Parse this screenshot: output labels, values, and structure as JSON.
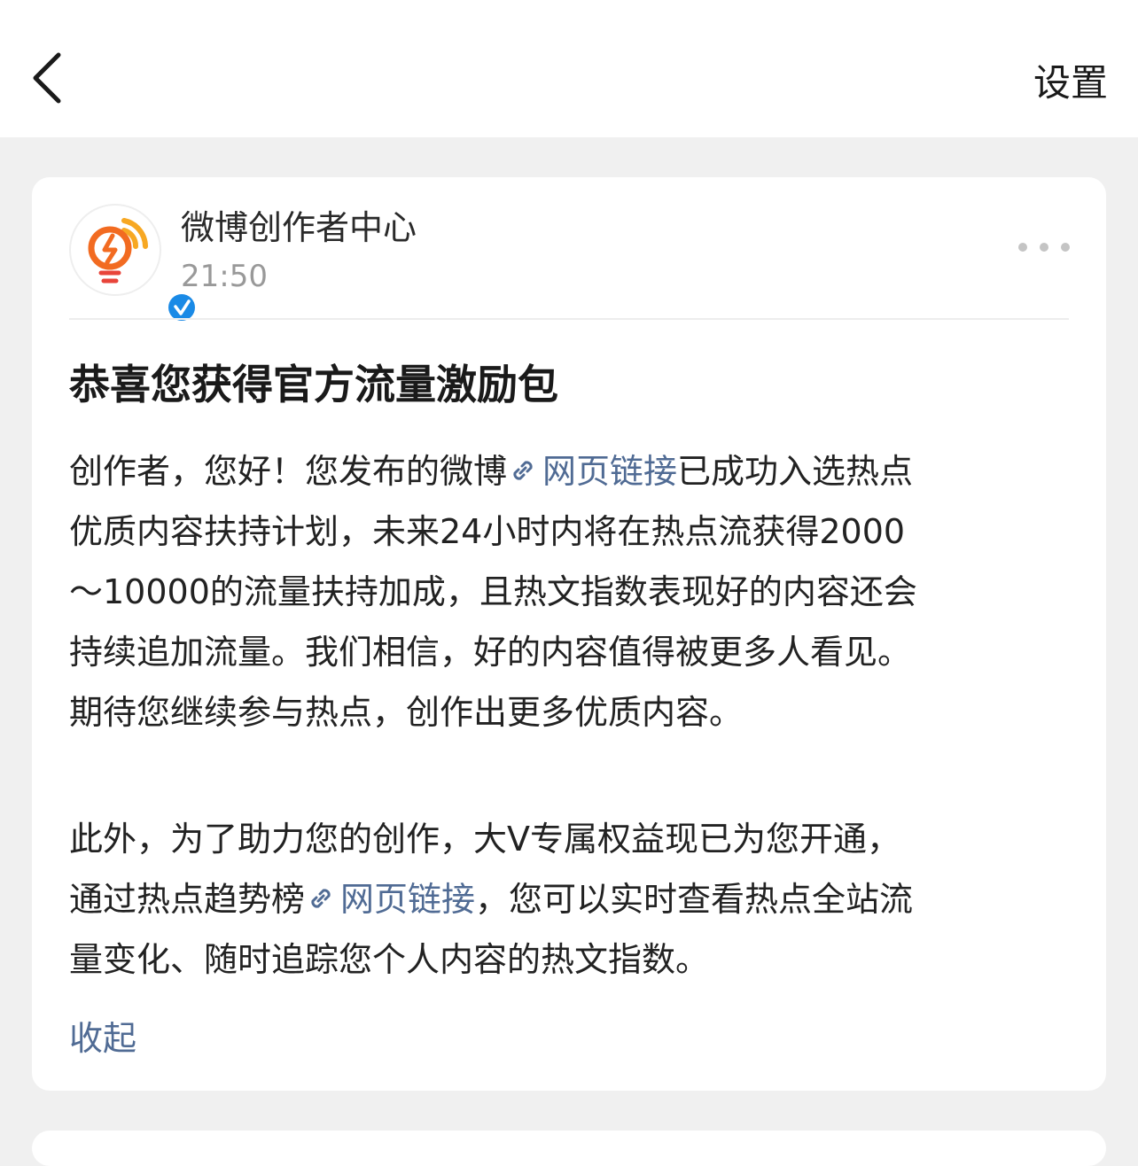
{
  "header": {
    "back_icon": "chevron-left-icon",
    "settings_label": "设置"
  },
  "post": {
    "account_name": "微博创作者中心",
    "time": "21:50",
    "avatar_icon": "lightbulb-lightning-icon",
    "verified_icon": "verified-check-icon",
    "more_icon": "ellipsis-icon",
    "title": "恭喜您获得官方流量激励包",
    "para1": {
      "l1_pre": "创作者，您好！您发布的微博",
      "l1_link": "网页链接",
      "l1_post": "已成功入选热点",
      "l2": "优质内容扶持计划，未来24小时内将在热点流获得2000",
      "l3": "～10000的流量扶持加成，且热文指数表现好的内容还会",
      "l4": "持续追加流量。我们相信，好的内容值得被更多人看见。",
      "l5": "期待您继续参与热点，创作出更多优质内容。"
    },
    "para2": {
      "l1": "此外，为了助力您的创作，大V专属权益现已为您开通，",
      "l2_pre": "通过热点趋势榜",
      "l2_link": "网页链接",
      "l2_post": "，您可以实时查看热点全站流",
      "l3": "量变化、随时追踪您个人内容的热文指数。"
    },
    "link_icon": "link-icon",
    "collapse_label": "收起"
  },
  "colors": {
    "link": "#506b94",
    "background": "#f0f0f0",
    "card": "#ffffff",
    "verified": "#1a8ae6",
    "avatar_accent": "#f26b21"
  }
}
